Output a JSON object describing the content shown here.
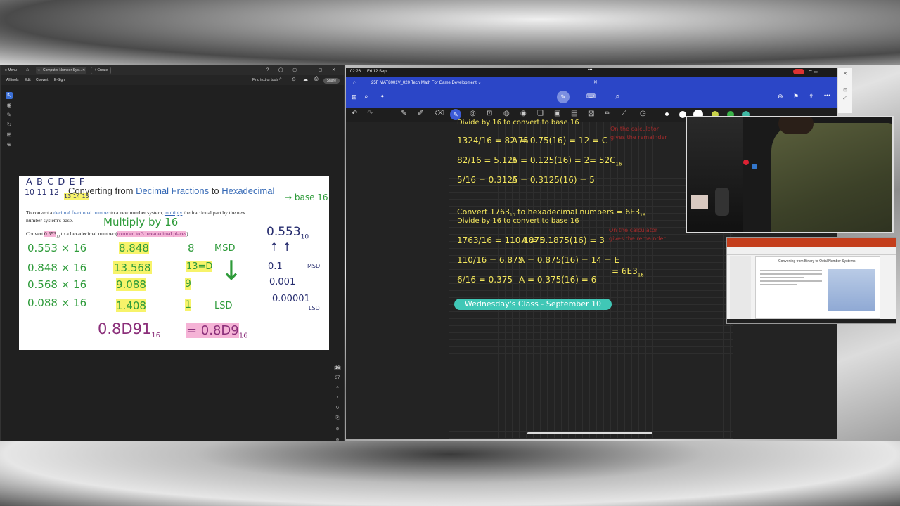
{
  "acrobat": {
    "menu_label": "Menu",
    "tab_title": "Computer Number Syst...",
    "create_label": "Create",
    "menubar": [
      "All tools",
      "Edit",
      "Convert",
      "E-Sign"
    ],
    "find_placeholder": "Find text or tools",
    "share_label": "Share",
    "page_number": "16",
    "page_total": "37"
  },
  "doc": {
    "hex_letters": "A B C D E F",
    "hex_values": "10 11 12",
    "hex_values2": "13 14 15",
    "title_prefix": "Converting from ",
    "title_decimal": "Decimal Fractions",
    "title_to": " to ",
    "title_hex": "Hexadecimal",
    "base16_note": "→ base 16",
    "intro_1": "To convert a ",
    "intro_link1": "decimal fractional number",
    "intro_2": " to a new number system, ",
    "intro_link2": "multiply",
    "intro_3": " the fractional part by the new",
    "intro_4": "number system's base.",
    "multiply_note": "Multiply by 16",
    "convert_prefix": "Convert ",
    "convert_value": "0.553",
    "convert_sub": "10",
    "convert_suffix": " to a hexadecimal number (",
    "convert_rounded": "rounded to 3 hexadecimal places",
    "convert_close": ").",
    "side_value": "0.553",
    "side_sub": "10",
    "rows": [
      {
        "expr": "0.553 × 16",
        "result": "8.848",
        "digit": "8",
        "label": "MSD"
      },
      {
        "expr": "0.848 × 16",
        "result": "13.568",
        "digit": "13=D",
        "label": ""
      },
      {
        "expr": "0.568 × 16",
        "result": "9.088",
        "digit": "9",
        "label": ""
      },
      {
        "expr": "0.088 × 16",
        "result": "1.408",
        "digit": "1",
        "label": "LSD"
      }
    ],
    "right_col": [
      "0.1",
      "0.001",
      "0.00001"
    ],
    "right_msd": "MSD",
    "right_lsd": "LSD",
    "answer_full": "0.8D91",
    "answer_round": "= 0.8D9",
    "answer_sub": "16"
  },
  "ipad": {
    "time": "02:26",
    "date": "Fri 12 Sep",
    "notebook_title": "25F MAT8001V_020 Tech Math For Game Development",
    "notes": {
      "divide_1": "Divide by 16 to convert to base 16",
      "eq1_left": "1324/16 = 82.75",
      "eq1_right": "A = 0.75(16) = 12 = C",
      "eq2_left": "82/16 = 5.125",
      "eq2_right": "A = 0.125(16) = 2",
      "result_1": "= 52C",
      "result_1_sub": "16",
      "eq3_left": "5/16 = 0.3125",
      "eq3_right": "A = 0.3125(16) = 5",
      "convert_2": "Convert 1763",
      "convert_2_sub": "10",
      "convert_2_rest": " to hexadecimal numbers = 6E3",
      "convert_2_ans_sub": "16",
      "divide_2": "Divide by 16 to convert to base 16",
      "eq4_left": "1763/16 = 110.1875",
      "eq4_right": "A = 0.1875(16) = 3",
      "eq5_left": "110/16 = 6.875",
      "eq5_right": "A = 0.875(16) = 14 = E",
      "result_2": "= 6E3",
      "result_2_sub": "16",
      "eq6_left": "6/16 = 0.375",
      "eq6_right": "A = 0.375(16) = 6",
      "red_note_1a": "On the calculator",
      "red_note_1b": "gives the remainder",
      "red_note_2a": "On the calculator",
      "red_note_2b": "gives the remainder",
      "banner": "Wednesday's Class - September 10"
    }
  },
  "powerpoint": {
    "slide_title": "Converting from Binary to Octal Number Systems"
  }
}
